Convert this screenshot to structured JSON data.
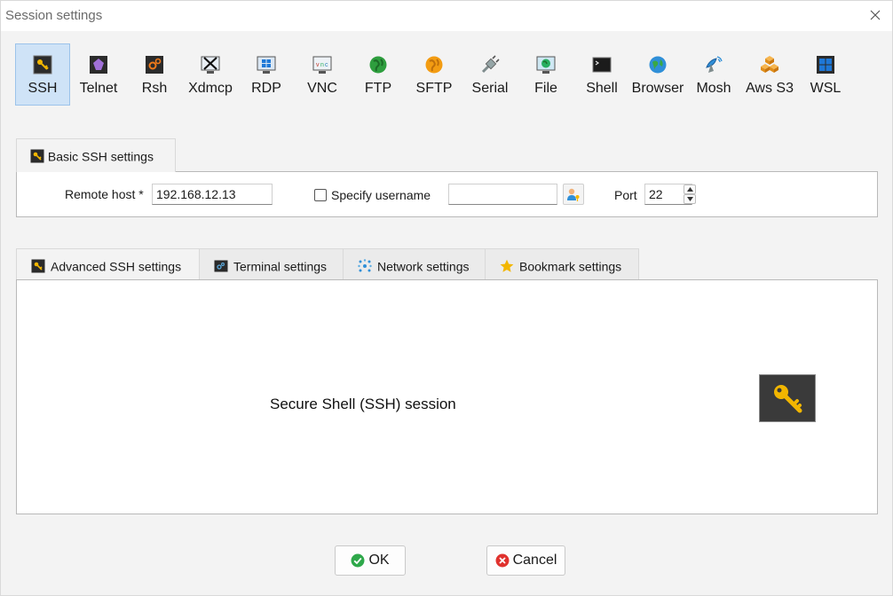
{
  "window": {
    "title": "Session settings"
  },
  "toolbar": {
    "items": [
      {
        "label": "SSH",
        "icon": "ssh-key-icon",
        "active": true
      },
      {
        "label": "Telnet",
        "icon": "telnet-icon"
      },
      {
        "label": "Rsh",
        "icon": "rsh-icon"
      },
      {
        "label": "Xdmcp",
        "icon": "xdmcp-icon"
      },
      {
        "label": "RDP",
        "icon": "rdp-icon"
      },
      {
        "label": "VNC",
        "icon": "vnc-icon"
      },
      {
        "label": "FTP",
        "icon": "ftp-globe-icon"
      },
      {
        "label": "SFTP",
        "icon": "sftp-globe-icon"
      },
      {
        "label": "Serial",
        "icon": "serial-plug-icon"
      },
      {
        "label": "File",
        "icon": "file-monitor-icon"
      },
      {
        "label": "Shell",
        "icon": "shell-terminal-icon"
      },
      {
        "label": "Browser",
        "icon": "browser-globe-icon"
      },
      {
        "label": "Mosh",
        "icon": "mosh-satellite-icon"
      },
      {
        "label": "Aws S3",
        "icon": "aws-cubes-icon"
      },
      {
        "label": "WSL",
        "icon": "wsl-windows-icon"
      }
    ]
  },
  "basic": {
    "tab_label": "Basic SSH settings",
    "remote_host_label": "Remote host *",
    "remote_host_value": "192.168.12.13",
    "specify_username_label": "Specify username",
    "username_value": "",
    "port_label": "Port",
    "port_value": "22"
  },
  "tabs": [
    {
      "label": "Advanced SSH settings",
      "icon": "ssh-key-icon"
    },
    {
      "label": "Terminal settings",
      "icon": "terminal-icon"
    },
    {
      "label": "Network settings",
      "icon": "network-icon"
    },
    {
      "label": "Bookmark settings",
      "icon": "star-icon"
    }
  ],
  "content": {
    "description": "Secure Shell (SSH) session"
  },
  "buttons": {
    "ok": "OK",
    "cancel": "Cancel"
  },
  "colors": {
    "accent": "#cfe3f7",
    "key_yellow": "#f2b600",
    "ok_green": "#2ea84a",
    "cancel_red": "#e0322e"
  }
}
